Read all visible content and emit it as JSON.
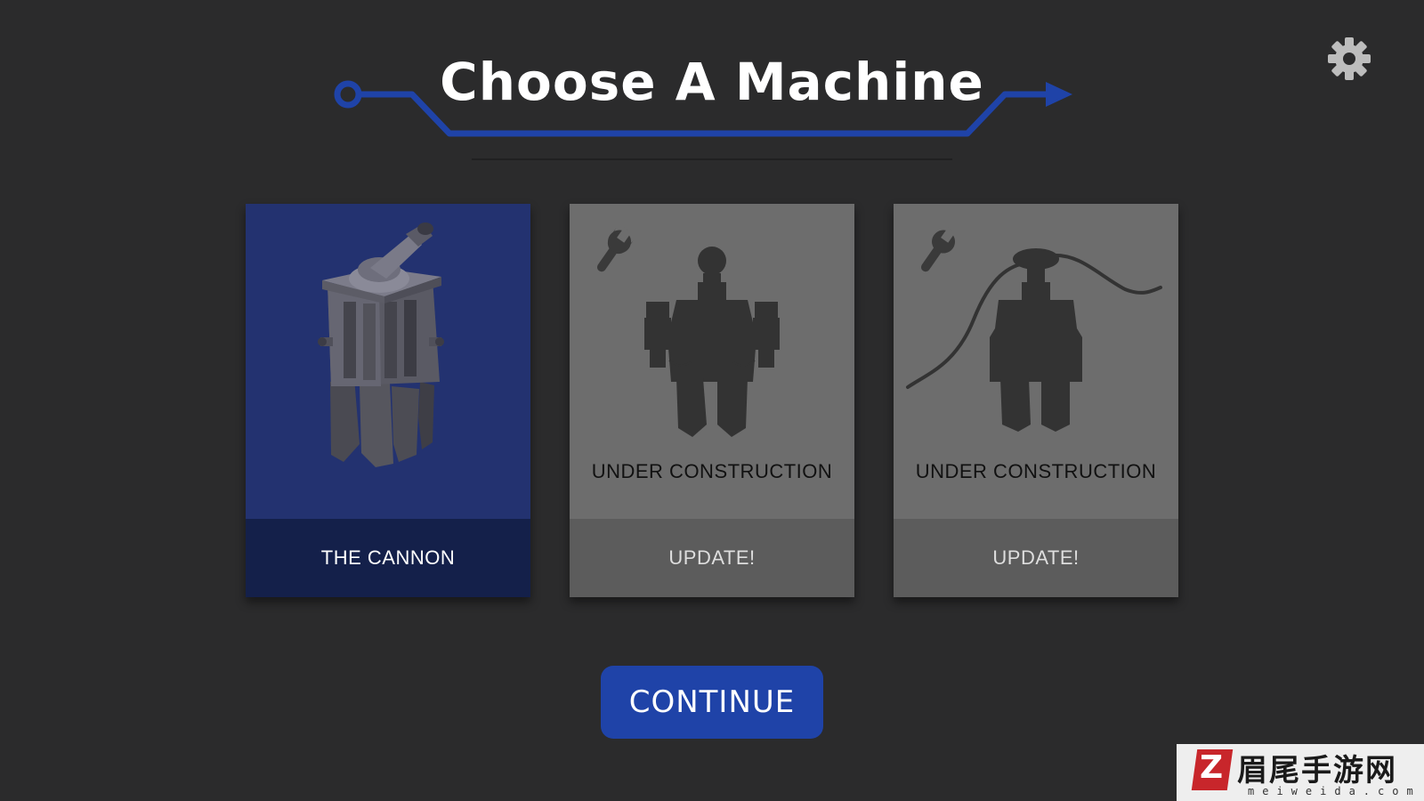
{
  "title": "Choose A Machine",
  "colors": {
    "background": "#2b2b2c",
    "accent": "#1f43a8",
    "card_active": "#233270",
    "card_active_footer": "#14204a",
    "card_locked": "#6d6d6d",
    "card_locked_footer": "#5c5c5c"
  },
  "settings": {
    "icon": "gear-icon"
  },
  "cards": [
    {
      "label": "THE CANNON",
      "state": "selected",
      "icon": "cannon-machine"
    },
    {
      "status": "UNDER CONSTRUCTION",
      "label": "UPDATE!",
      "state": "locked",
      "icon": "wrench-icon"
    },
    {
      "status": "UNDER CONSTRUCTION",
      "label": "UPDATE!",
      "state": "locked",
      "icon": "wrench-icon"
    }
  ],
  "continue_label": "CONTINUE",
  "watermark": {
    "logo_letter": "Z",
    "text": "眉尾手游网",
    "subtext": "meiweida.com"
  }
}
